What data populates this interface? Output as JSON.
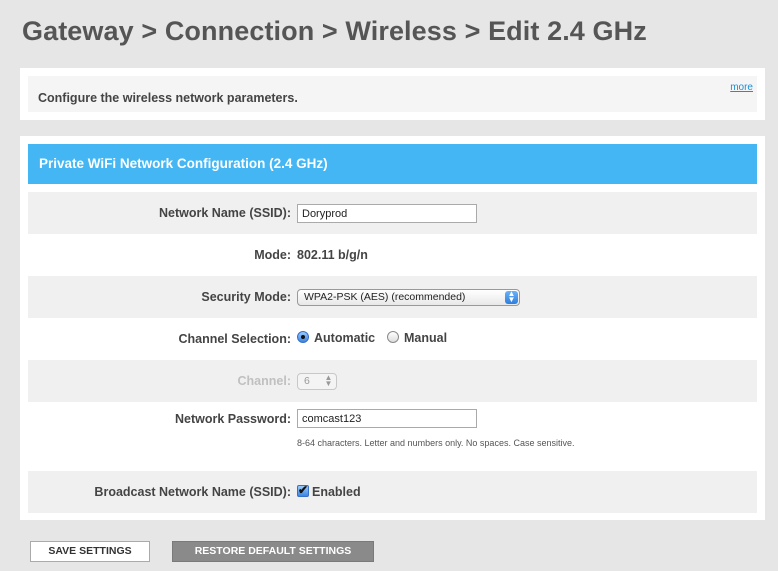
{
  "page": {
    "title": "Gateway > Connection > Wireless > Edit 2.4 GHz"
  },
  "intro": {
    "text": "Configure the wireless network parameters.",
    "more_link": "more"
  },
  "config": {
    "header": "Private WiFi Network Configuration (2.4 GHz)",
    "ssid": {
      "label": "Network Name (SSID):",
      "value": "Doryprod"
    },
    "mode": {
      "label": "Mode:",
      "value": "802.11 b/g/n"
    },
    "security": {
      "label": "Security Mode:",
      "selected": "WPA2-PSK (AES) (recommended)"
    },
    "channel_selection": {
      "label": "Channel Selection:",
      "options": [
        "Automatic",
        "Manual"
      ],
      "selected": "Automatic"
    },
    "channel": {
      "label": "Channel:",
      "selected": "6",
      "enabled": false
    },
    "password": {
      "label": "Network Password:",
      "value": "comcast123",
      "hint": "8-64 characters. Letter and numbers only. No spaces. Case sensitive."
    },
    "broadcast": {
      "label": "Broadcast Network Name (SSID):",
      "checkbox_label": "Enabled",
      "checked": true
    }
  },
  "buttons": {
    "save": "SAVE SETTINGS",
    "restore": "RESTORE DEFAULT SETTINGS"
  },
  "colors": {
    "header_accent": "#44b6f4",
    "link": "#1a8fd6"
  }
}
